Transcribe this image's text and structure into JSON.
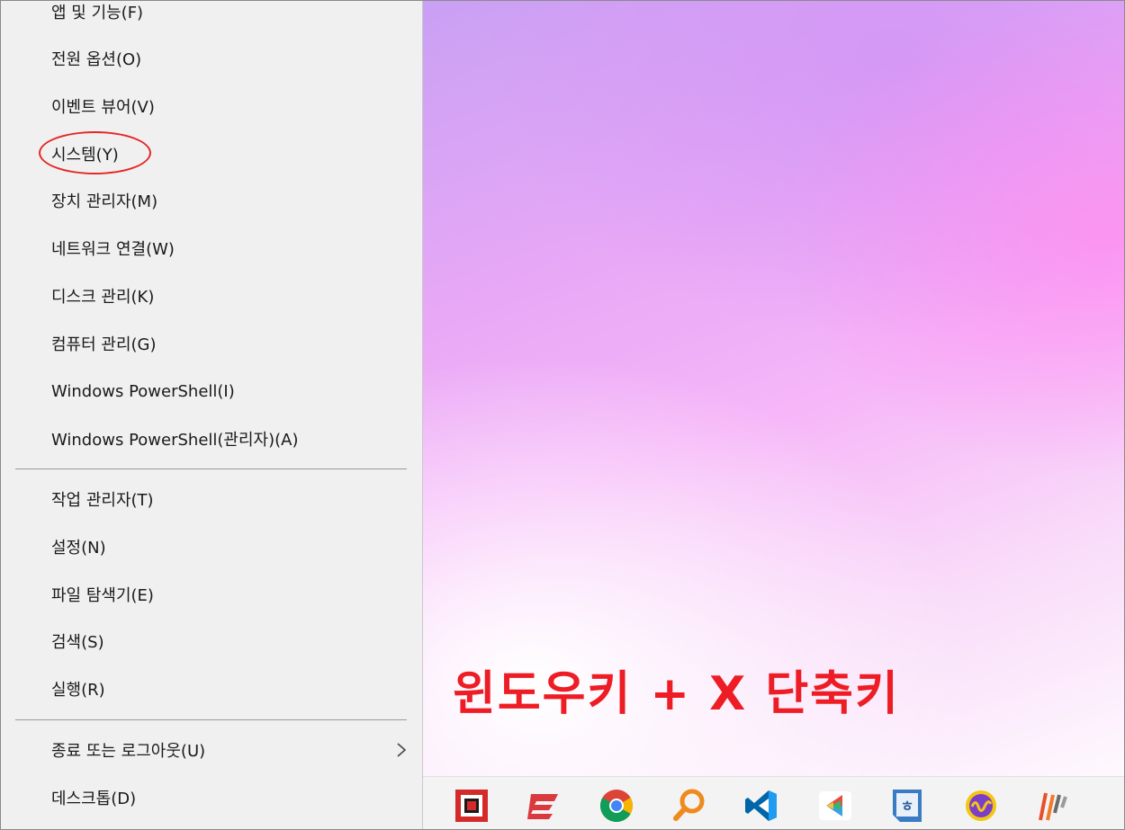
{
  "context_menu": {
    "items_group1": [
      {
        "label": "앱 및 기능(F)"
      },
      {
        "label": "전원 옵션(O)"
      },
      {
        "label": "이벤트 뷰어(V)"
      },
      {
        "label": "시스템(Y)"
      },
      {
        "label": "장치 관리자(M)"
      },
      {
        "label": "네트워크 연결(W)"
      },
      {
        "label": "디스크 관리(K)"
      },
      {
        "label": "컴퓨터 관리(G)"
      },
      {
        "label": "Windows PowerShell(I)"
      },
      {
        "label": "Windows PowerShell(관리자)(A)"
      }
    ],
    "items_group2": [
      {
        "label": "작업 관리자(T)"
      },
      {
        "label": "설정(N)"
      },
      {
        "label": "파일 탐색기(E)"
      },
      {
        "label": "검색(S)"
      },
      {
        "label": "실행(R)"
      }
    ],
    "items_group3": [
      {
        "label": "종료 또는 로그아웃(U)",
        "has_submenu": true
      },
      {
        "label": "데스크톱(D)"
      }
    ],
    "highlighted_item": "시스템(Y)"
  },
  "desktop": {
    "caption": "윈도우키 + X 단축키",
    "caption_color": "#ee1c24"
  },
  "taskbar": {
    "icons": [
      "red-square-app-icon",
      "express-vpn-icon",
      "chrome-icon",
      "search-magnifier-app-icon",
      "vscode-icon",
      "colorful-arrow-app-icon",
      "hangul-word-icon",
      "wave-yellow-app-icon",
      "stripes-app-icon"
    ]
  },
  "colors": {
    "menu_background": "#f0f0f0",
    "highlight_circle": "#e52626"
  }
}
